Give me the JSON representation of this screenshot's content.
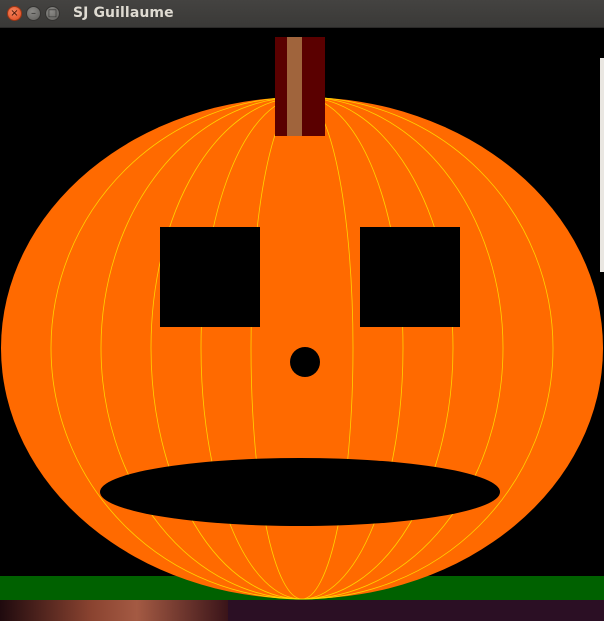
{
  "window": {
    "title": "SJ Guillaume",
    "controls": {
      "close_icon": "×",
      "minimize_icon": "–",
      "maximize_icon": "□"
    }
  },
  "scene": {
    "background_color": "#000000",
    "ground_color": "#006100",
    "pumpkin_color": "#ff6a00",
    "rib_line_color": "#ffd400",
    "stem_outer_color": "#5a0000",
    "stem_inner_color": "#a0643c",
    "face_color": "#000000"
  }
}
